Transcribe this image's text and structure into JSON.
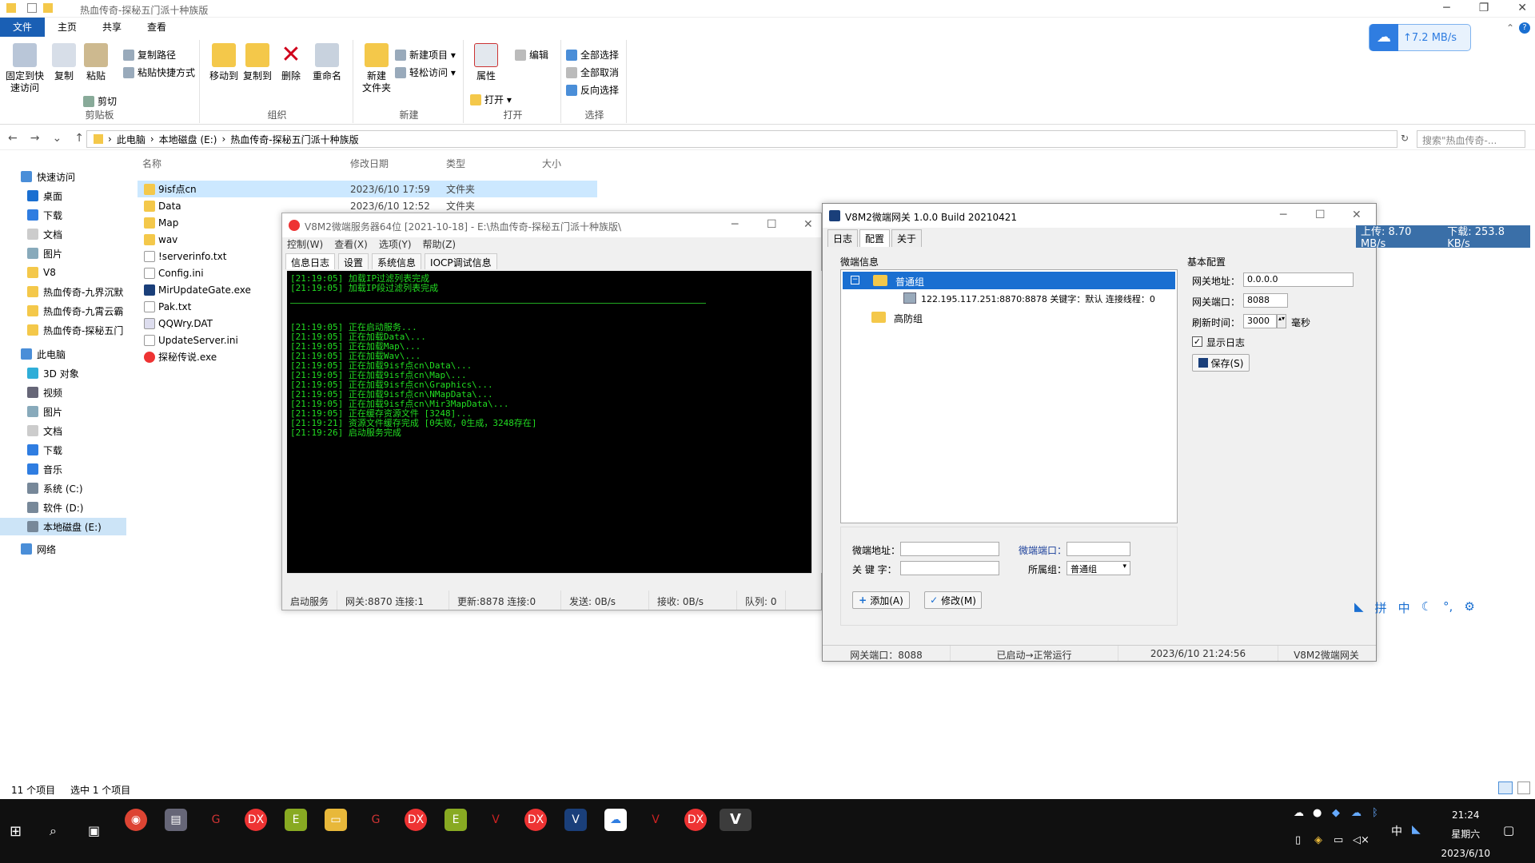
{
  "explorer": {
    "title": "热血传奇-探秘五门派十种族版",
    "menu_tabs": [
      "文件",
      "主页",
      "共享",
      "查看"
    ],
    "ribbon": {
      "clipboard": {
        "pin": "固定到快\n速访问",
        "copy": "复制",
        "paste": "粘贴",
        "copy_path": "复制路径",
        "paste_shortcut": "粘贴快捷方式",
        "cut": "剪切",
        "label": "剪贴板"
      },
      "organize": {
        "move_to": "移动到",
        "copy_to": "复制到",
        "delete": "删除",
        "rename": "重命名",
        "label": "组织"
      },
      "new": {
        "new_folder": "新建\n文件夹",
        "new_item": "新建项目 ▾",
        "easy_access": "轻松访问 ▾",
        "label": "新建"
      },
      "open": {
        "properties": "属性",
        "open": "打开 ▾",
        "edit": "编辑",
        "label": "打开"
      },
      "select": {
        "select_all": "全部选择",
        "select_none": "全部取消",
        "invert": "反向选择",
        "label": "选择"
      }
    },
    "cloud_speed": "↑7.2 MB/s",
    "breadcrumbs": [
      "此电脑",
      "本地磁盘 (E:)",
      "热血传奇-探秘五门派十种族版"
    ],
    "search_placeholder": "搜索\"热血传奇-...",
    "nav": [
      "快速访问",
      "桌面",
      "下载",
      "文档",
      "图片",
      "V8",
      "热血传奇-九界沉默",
      "热血传奇-九霄云霸",
      "热血传奇-探秘五门",
      "此电脑",
      "3D 对象",
      "视频",
      "图片",
      "文档",
      "下载",
      "音乐",
      "系统 (C:)",
      "软件 (D:)",
      "本地磁盘 (E:)",
      "网络"
    ],
    "columns": {
      "name": "名称",
      "date": "修改日期",
      "type": "类型",
      "size": "大小"
    },
    "files": [
      {
        "name": "9isf点cn",
        "date": "2023/6/10 17:59",
        "type": "文件夹"
      },
      {
        "name": "Data",
        "date": "2023/6/10 12:52",
        "type": "文件夹"
      },
      {
        "name": "Map",
        "date": "",
        "type": ""
      },
      {
        "name": "wav",
        "date": "",
        "type": ""
      },
      {
        "name": "!serverinfo.txt",
        "date": "",
        "type": ""
      },
      {
        "name": "Config.ini",
        "date": "",
        "type": ""
      },
      {
        "name": "MirUpdateGate.exe",
        "date": "",
        "type": ""
      },
      {
        "name": "Pak.txt",
        "date": "",
        "type": ""
      },
      {
        "name": "QQWry.DAT",
        "date": "",
        "type": ""
      },
      {
        "name": "UpdateServer.ini",
        "date": "",
        "type": ""
      },
      {
        "name": "探秘传说.exe",
        "date": "",
        "type": ""
      }
    ],
    "status": {
      "count": "11 个项目",
      "selected": "选中 1 个项目"
    }
  },
  "server": {
    "title": "V8M2微端服务器64位 [2021-10-18] - E:\\热血传奇-探秘五门派十种族版\\",
    "menu": [
      "控制(W)",
      "查看(X)",
      "选项(Y)",
      "帮助(Z)"
    ],
    "tabs": [
      "信息日志",
      "设置",
      "系统信息",
      "IOCP调试信息"
    ],
    "log_top": [
      "[21:19:05] 加载IP过滤列表完成",
      "[21:19:05] 加载IP段过滤列表完成"
    ],
    "log": [
      "[21:19:05] 正在启动服务...",
      "[21:19:05] 正在加载Data\\...",
      "[21:19:05] 正在加载Map\\...",
      "[21:19:05] 正在加载Wav\\...",
      "[21:19:05] 正在加载9isf点cn\\Data\\...",
      "[21:19:05] 正在加载9isf点cn\\Map\\...",
      "[21:19:05] 正在加载9isf点cn\\Graphics\\...",
      "[21:19:05] 正在加载9isf点cn\\NMapData\\...",
      "[21:19:05] 正在加载9isf点cn\\Mir3MapData\\...",
      "[21:19:05] 正在缓存资源文件 [3248]...",
      "[21:19:21] 资源文件缓存完成 [0失败，0生成，3248存在]",
      "[21:19:26] 启动服务完成"
    ],
    "status": [
      "启动服务",
      "网关:8870  连接:1",
      "更新:8878  连接:0",
      "发送: 0B/s",
      "接收: 0B/s",
      "队列: 0"
    ]
  },
  "gateway": {
    "title": "V8M2微端网关 1.0.0 Build 20210421",
    "tabs": [
      "日志",
      "配置",
      "关于"
    ],
    "micro_info_label": "微端信息",
    "groups": {
      "normal": "普通组",
      "entry": "122.195.117.251:8870:8878 关键字：默认 连接线程：0",
      "ddos": "高防组"
    },
    "basic_label": "基本配置",
    "gw_addr_label": "网关地址：",
    "gw_addr": "0.0.0.0",
    "gw_port_label": "网关端口：",
    "gw_port": "8088",
    "refresh_label": "刷新时间：",
    "refresh": "3000",
    "ms_label": "毫秒",
    "show_log": "显示日志",
    "save": "保存(S)",
    "form": {
      "addr": "微端地址：",
      "port": "微端端口：",
      "keyword": "关 键 字：",
      "group": "所属组：",
      "group_val": "普通组",
      "add": "添加(A)",
      "modify": "修改(M)"
    },
    "status": [
      "网关端口：8088",
      "已启动→正常运行",
      "2023/6/10 21:24:56",
      "V8M2微端网关"
    ]
  },
  "netspeed": {
    "up": "上传: 8.70 MB/s",
    "down": "下载: 253.8 KB/s"
  },
  "taskbar": {
    "time": "21:24",
    "weekday": "星期六",
    "date": "2023/6/10",
    "ime": "中"
  },
  "colors": {
    "accent": "#1a6fd1",
    "console_text": "#22dd22",
    "console_bg": "#000000",
    "taskbar": "#101010"
  }
}
